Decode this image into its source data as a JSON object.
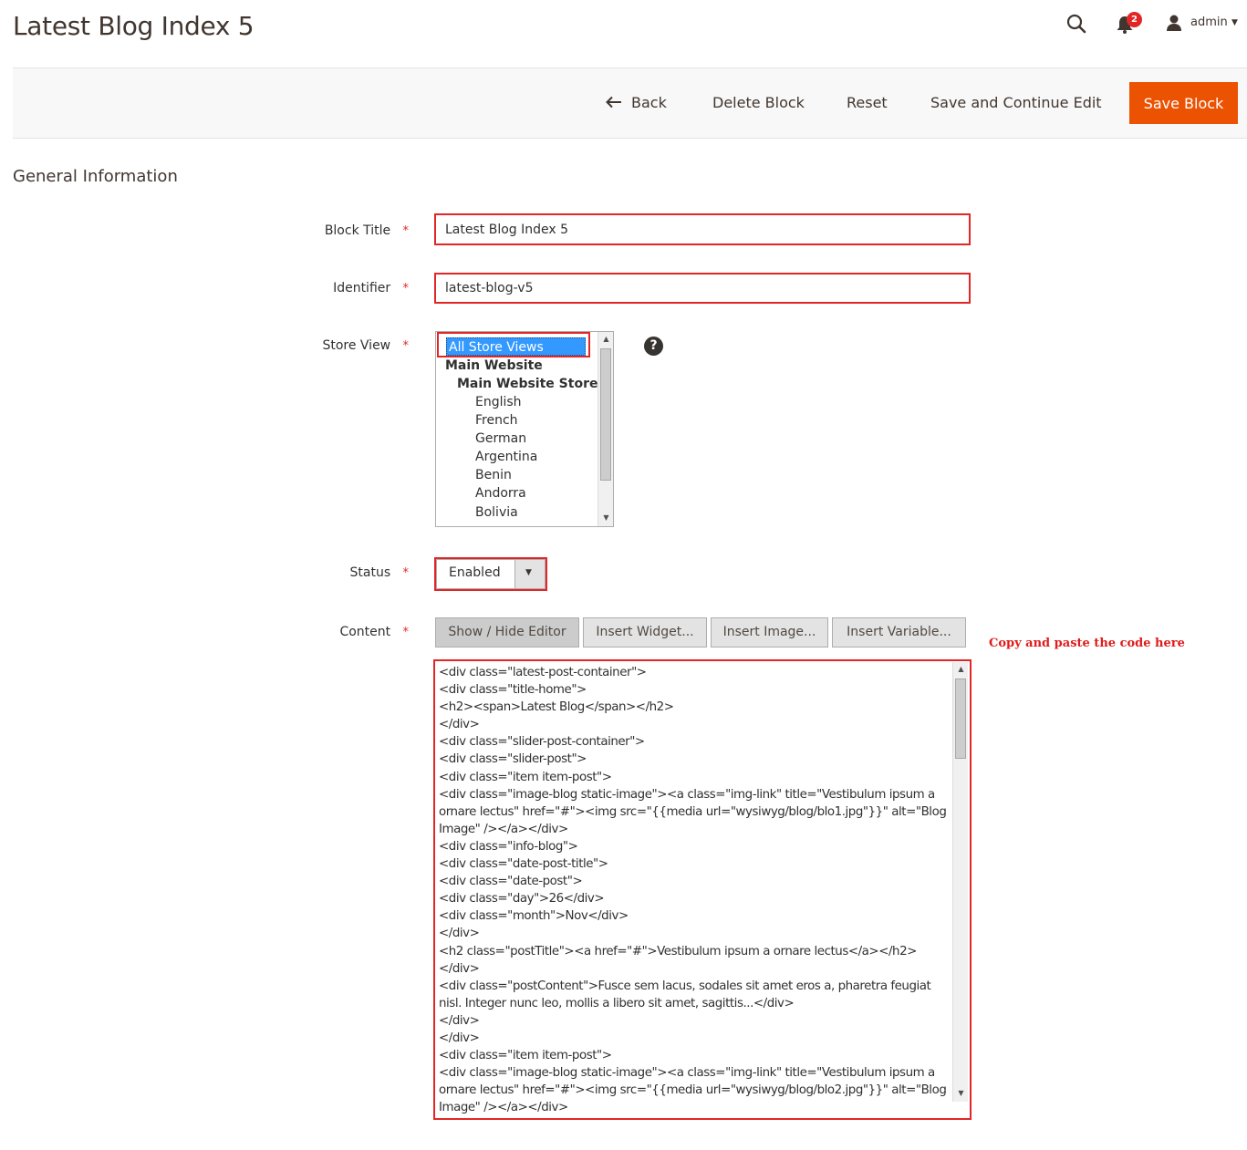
{
  "header": {
    "page_title": "Latest Blog Index 5",
    "notification_count": "2",
    "user_name": "admin",
    "icons": [
      "search-icon",
      "bell-icon",
      "user-icon",
      "chevron-down-icon"
    ]
  },
  "toolbar": {
    "back_label": "Back",
    "delete_label": "Delete Block",
    "reset_label": "Reset",
    "save_continue_label": "Save and Continue Edit",
    "save_label": "Save Block",
    "accent_color": "#eb5202"
  },
  "section": {
    "title": "General Information"
  },
  "form": {
    "required_marker": "*",
    "block_title": {
      "label": "Block Title",
      "value": "Latest Blog Index 5"
    },
    "identifier": {
      "label": "Identifier",
      "value": "latest-blog-v5"
    },
    "store_view": {
      "label": "Store View",
      "options": [
        {
          "text": "All Store Views",
          "selected": true
        },
        {
          "text": "Main Website",
          "group": true
        },
        {
          "text": "Main Website Store",
          "group": true
        },
        {
          "text": "English"
        },
        {
          "text": "French"
        },
        {
          "text": "German"
        },
        {
          "text": "Argentina"
        },
        {
          "text": "Benin"
        },
        {
          "text": "Andorra"
        },
        {
          "text": "Bolivia"
        }
      ],
      "help_glyph": "?"
    },
    "status": {
      "label": "Status",
      "value": "Enabled"
    },
    "content": {
      "label": "Content",
      "buttons": {
        "show_hide": "Show / Hide Editor",
        "insert_widget": "Insert Widget...",
        "insert_image": "Insert Image...",
        "insert_variable": "Insert Variable..."
      },
      "lines": [
        "<div class=\"latest-post-container\">",
        "<div class=\"title-home\">",
        "<h2><span>Latest Blog</span></h2>",
        "</div>",
        "<div class=\"slider-post-container\">",
        "<div class=\"slider-post\">",
        "<div class=\"item item-post\">",
        "<div class=\"image-blog static-image\"><a class=\"img-link\" title=\"Vestibulum ipsum a",
        "ornare lectus\" href=\"#\"><img src=\"{{media url=\"wysiwyg/blog/blo1.jpg\"}}\" alt=\"Blog",
        "Image\" /></a></div>",
        "<div class=\"info-blog\">",
        "<div class=\"date-post-title\">",
        "<div class=\"date-post\">",
        "<div class=\"day\">26</div>",
        "<div class=\"month\">Nov</div>",
        "</div>",
        "<h2 class=\"postTitle\"><a href=\"#\">Vestibulum ipsum a ornare lectus</a></h2>",
        "</div>",
        "<div class=\"postContent\">Fusce sem lacus, sodales sit amet eros a, pharetra feugiat",
        "nisl. Integer nunc leo, mollis a libero sit amet, sagittis...</div>",
        "</div>",
        "</div>",
        "<div class=\"item item-post\">",
        "<div class=\"image-blog static-image\"><a class=\"img-link\" title=\"Vestibulum ipsum a",
        "ornare lectus\" href=\"#\"><img src=\"{{media url=\"wysiwyg/blog/blo2.jpg\"}}\" alt=\"Blog",
        "Image\" /></a></div>"
      ]
    }
  },
  "annotation": {
    "text": "Copy and paste the code here",
    "color": "#e01b1b"
  }
}
